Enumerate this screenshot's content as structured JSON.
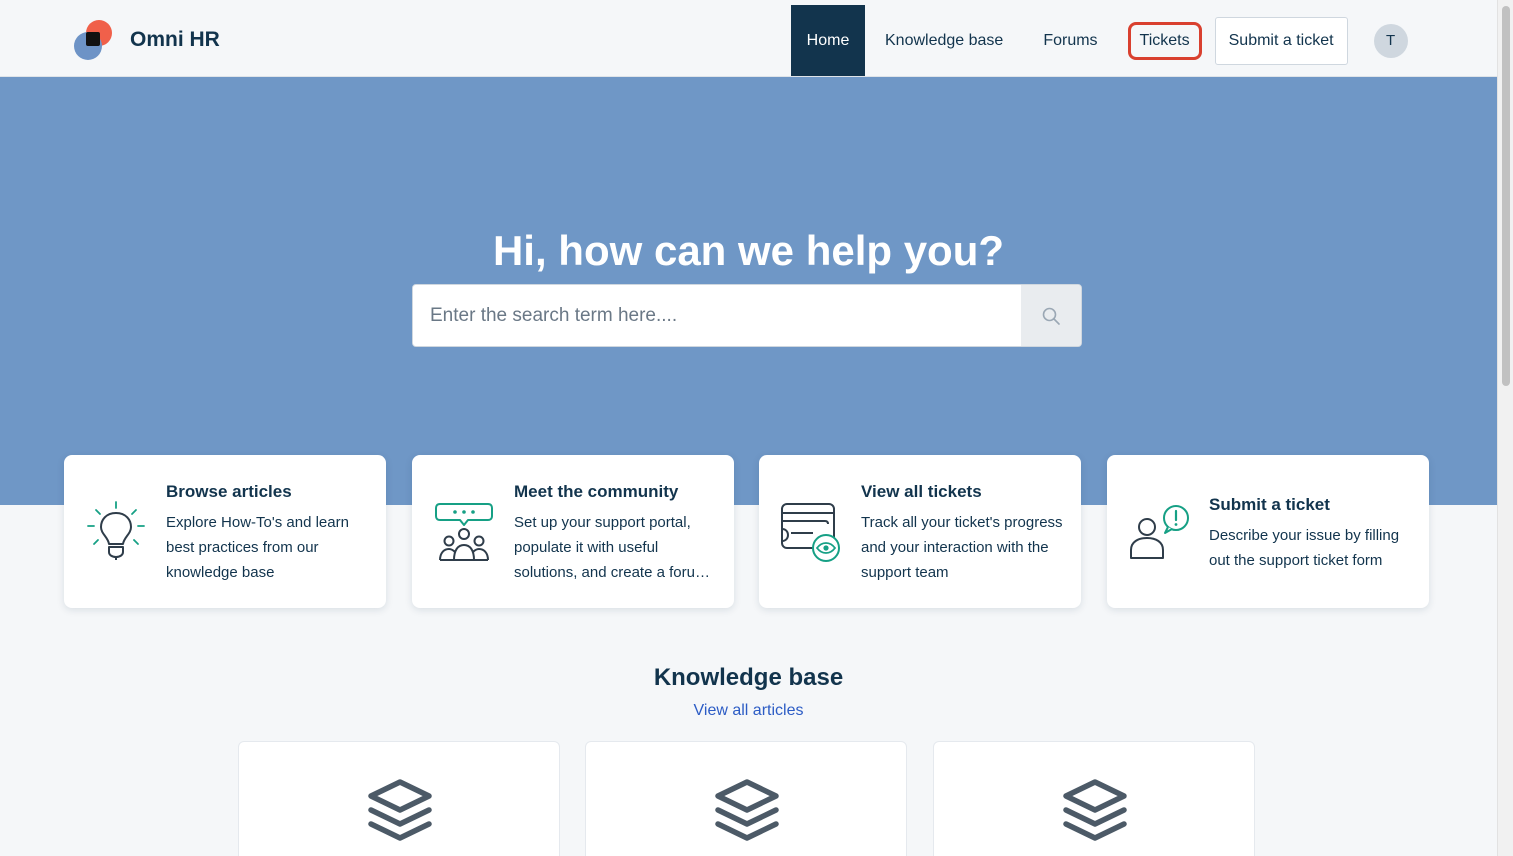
{
  "brand": {
    "name": "Omni HR"
  },
  "nav": {
    "home": "Home",
    "knowledge_base": "Knowledge base",
    "forums": "Forums",
    "tickets": "Tickets",
    "submit_ticket": "Submit a ticket",
    "avatar_initial": "T"
  },
  "hero": {
    "title": "Hi, how can we help you?",
    "search_placeholder": "Enter the search term here...."
  },
  "cards": [
    {
      "title": "Browse articles",
      "desc": "Explore How-To's and learn best practices from our knowledge base",
      "icon": "lightbulb-icon"
    },
    {
      "title": "Meet the community",
      "desc": "Set up your support portal, populate it with useful solutions, and create a forum community",
      "icon": "community-icon"
    },
    {
      "title": "View all tickets",
      "desc": "Track all your ticket's progress and your interaction with the support team",
      "icon": "tickets-view-icon"
    },
    {
      "title": "Submit a ticket",
      "desc": "Describe your issue by filling out the support ticket form",
      "icon": "person-alert-icon"
    }
  ],
  "knowledge_base": {
    "title": "Knowledge base",
    "view_all": "View all articles",
    "category_icon": "layers-icon"
  },
  "colors": {
    "primary": "#12344d",
    "hero_bg": "#6f97c6",
    "accent_green": "#16a085",
    "highlight_red": "#d9402f",
    "link": "#2c5cc5"
  }
}
